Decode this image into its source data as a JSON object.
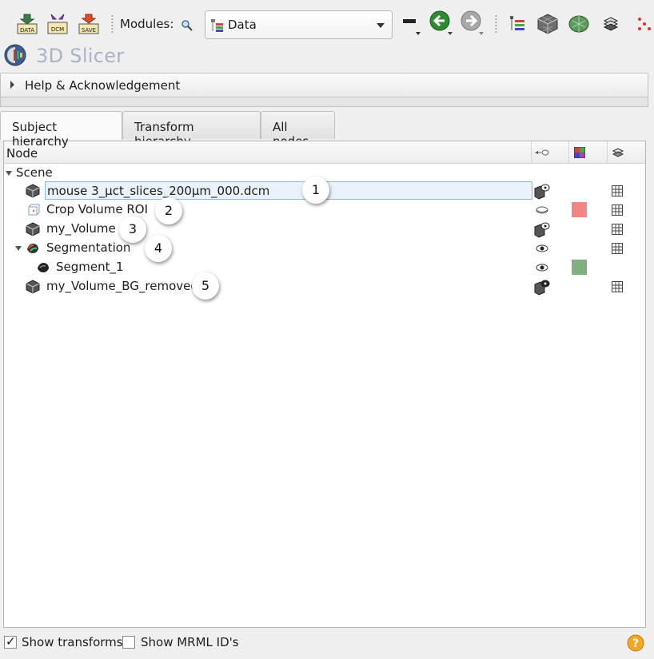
{
  "toolbar": {
    "buttons": [
      {
        "name": "load-data-button",
        "label": "DATA"
      },
      {
        "name": "dicom-button",
        "label": "DCM"
      },
      {
        "name": "save-button",
        "label": "SAVE"
      }
    ],
    "modules_label": "Modules:",
    "module_selected": "Data",
    "icons": [
      "search-icon",
      "view-layout-icon",
      "back-arrow-icon",
      "forward-arrow-icon",
      "subject-hierarchy-icon",
      "volume-rendering-icon",
      "models-icon",
      "segment-editor-icon",
      "markups-icon"
    ]
  },
  "app": {
    "title": "3D Slicer"
  },
  "help_section": {
    "label": "Help & Acknowledgement"
  },
  "tabs": [
    {
      "label": "Subject hierarchy",
      "active": true
    },
    {
      "label": "Transform hierarchy",
      "active": false
    },
    {
      "label": "All nodes",
      "active": false
    }
  ],
  "tree": {
    "header": {
      "node": "Node",
      "icons": [
        "visibility-header-icon",
        "color-header-icon",
        "transform-header-icon"
      ]
    },
    "rows": [
      {
        "name": "Scene",
        "depth": 0,
        "expanded": true,
        "icon": "scene"
      },
      {
        "name": "mouse 3_µct_slices_200µm_000.dcm",
        "depth": 1,
        "icon": "volume-icon",
        "selected": true,
        "callout": "1",
        "visibility": "volume-visible",
        "color": null
      },
      {
        "name": "Crop Volume ROI",
        "depth": 1,
        "icon": "roi-icon",
        "callout": "2",
        "visibility": "eye-closed",
        "color": "#f28585"
      },
      {
        "name": "my_Volume",
        "depth": 1,
        "icon": "volume-icon",
        "callout": "3",
        "visibility": "volume-visible",
        "color": null
      },
      {
        "name": "Segmentation",
        "depth": 1,
        "expanded": true,
        "icon": "segmentation-icon",
        "callout": "4",
        "visibility": "eye-open",
        "color": null
      },
      {
        "name": "Segment_1",
        "depth": 2,
        "icon": "segment-icon",
        "visibility": "eye-open",
        "color": "#80b080"
      },
      {
        "name": "my_Volume_BG_removed",
        "depth": 1,
        "icon": "volume-icon",
        "callout": "5",
        "visibility": "volume-visible",
        "color": null
      }
    ]
  },
  "footer": {
    "show_transforms": {
      "label": "Show transforms",
      "checked": true
    },
    "show_mrml_ids": {
      "label": "Show MRML ID's",
      "checked": false
    }
  }
}
